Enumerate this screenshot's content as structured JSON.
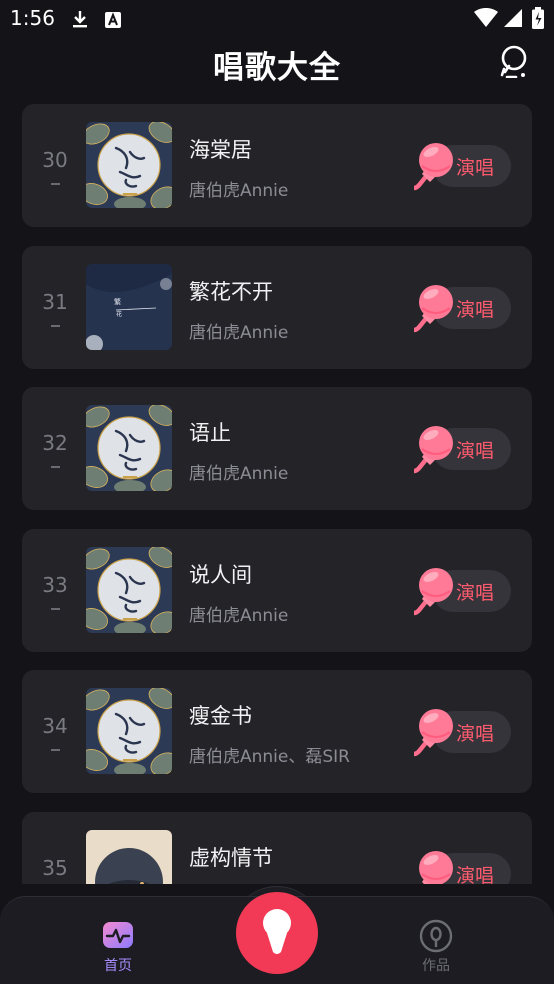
{
  "status_bar": {
    "time": "1:56"
  },
  "header": {
    "title": "唱歌大全"
  },
  "sing_label": "演唱",
  "songs": [
    {
      "rank": "30",
      "title": "海棠居",
      "artist": "唐伯虎Annie"
    },
    {
      "rank": "31",
      "title": "繁花不开",
      "artist": "唐伯虎Annie"
    },
    {
      "rank": "32",
      "title": "语止",
      "artist": "唐伯虎Annie"
    },
    {
      "rank": "33",
      "title": "说人间",
      "artist": "唐伯虎Annie"
    },
    {
      "rank": "34",
      "title": "瘦金书",
      "artist": "唐伯虎Annie、磊SIR"
    },
    {
      "rank": "35",
      "title": "虚构情节",
      "artist": ""
    }
  ],
  "nav": {
    "home": "首页",
    "works": "作品"
  },
  "colors": {
    "accent_red": "#f23a56",
    "sing_text": "#ff5a6e",
    "mic_pink": "#ff7a96",
    "nav_active": "#a88cff"
  }
}
